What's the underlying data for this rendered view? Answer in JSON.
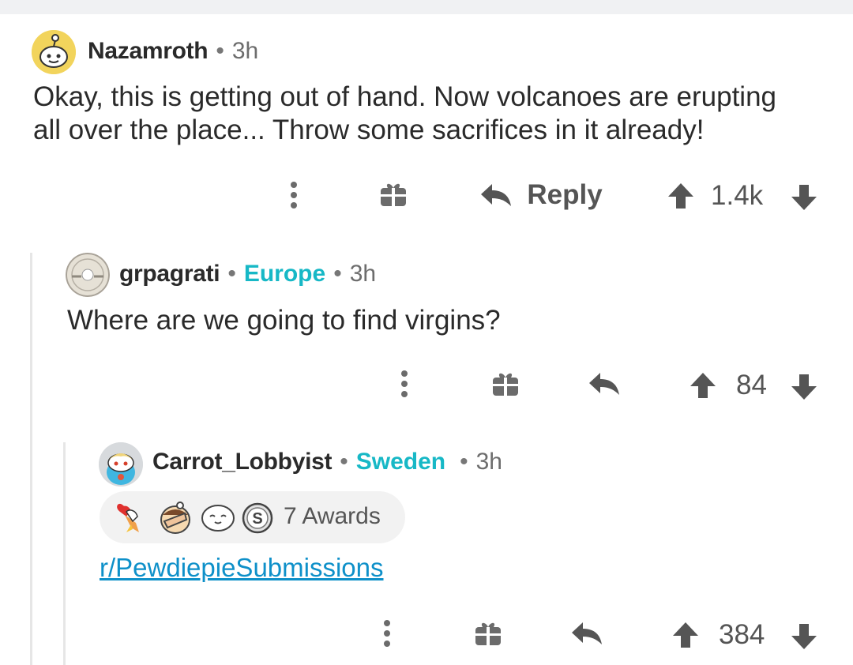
{
  "colors": {
    "flair": "#17b8c6",
    "link": "#0e90c9",
    "icon": "#6b6b6b",
    "thread_line": "#e6e6e6"
  },
  "comments": [
    {
      "username": "Nazamroth",
      "separator": "•",
      "time": "3h",
      "body_lines": [
        "Okay, this is getting out of hand. Now volcanoes are erupting",
        "all over the place... Throw some sacrifices in it already!"
      ],
      "reply_label": "Reply",
      "score": "1.4k",
      "icons": [
        "more-vertical-icon",
        "gift-icon",
        "reply-arrow-icon",
        "upvote-icon",
        "downvote-icon"
      ]
    },
    {
      "username": "grpagrati",
      "separator": "•",
      "flair": "Europe",
      "separator2": "•",
      "time": "3h",
      "body": "Where are we going to find virgins?",
      "score": "84",
      "icons": [
        "more-vertical-icon",
        "gift-icon",
        "reply-arrow-icon",
        "upvote-icon",
        "downvote-icon"
      ]
    },
    {
      "username": "Carrot_Lobbyist",
      "separator": "•",
      "flair": "Sweden",
      "separator2": "•",
      "time": "3h",
      "awards_label": "7 Awards",
      "award_icons": [
        "rocket-heart-award-icon",
        "facepalm-award-icon",
        "wholesome-seal-award-icon",
        "silver-award-icon"
      ],
      "link_text": "r/PewdiepieSubmissions",
      "score": "384",
      "icons": [
        "more-vertical-icon",
        "gift-icon",
        "reply-arrow-icon",
        "upvote-icon",
        "downvote-icon"
      ]
    }
  ]
}
